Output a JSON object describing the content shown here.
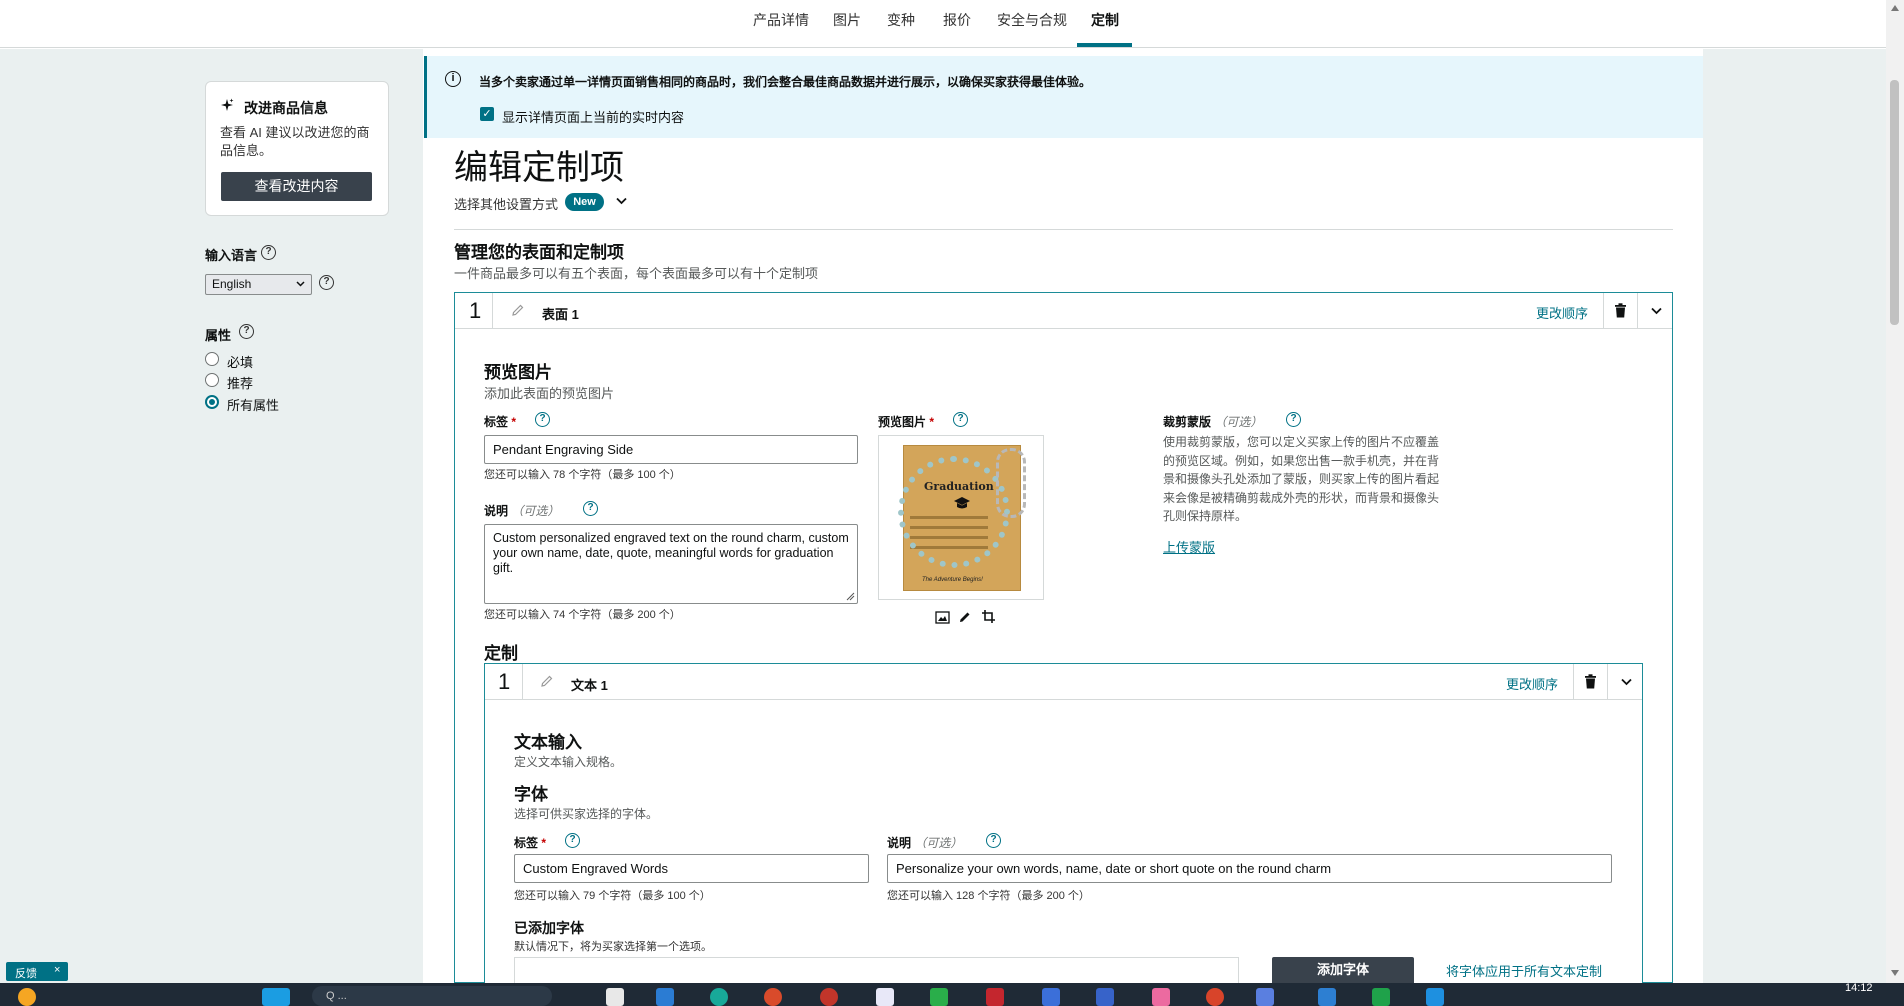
{
  "topnav": {
    "tabs": [
      "产品详情",
      "图片",
      "变种",
      "报价",
      "安全与合规",
      "定制"
    ],
    "active_index": 5
  },
  "sidebar": {
    "improve": {
      "title": "改进商品信息",
      "desc": "查看 AI 建议以改进您的商品信息。",
      "button": "查看改进内容"
    },
    "language": {
      "label": "输入语言",
      "value": "English"
    },
    "attributes": {
      "label": "属性",
      "options": [
        "必填",
        "推荐",
        "所有属性"
      ],
      "selected_index": 2
    }
  },
  "banner": {
    "text": "当多个卖家通过单一详情页面销售相同的商品时，我们会整合最佳商品数据并进行展示，以确保买家获得最佳体验。",
    "checkbox_label": "显示详情页面上当前的实时内容",
    "checked": true
  },
  "page": {
    "title": "编辑定制项",
    "setup_label": "选择其他设置方式",
    "badge": "New"
  },
  "manage": {
    "title": "管理您的表面和定制项",
    "subtitle": "一件商品最多可以有五个表面，每个表面最多可以有十个定制项"
  },
  "surface": {
    "index": "1",
    "name": "表面 1",
    "reorder": "更改顺序",
    "preview": {
      "title": "预览图片",
      "subtitle": "添加此表面的预览图片",
      "label_label": "标签",
      "label_value": "Pendant Engraving Side",
      "label_hint": "您还可以输入 78 个字符（最多 100 个）",
      "desc_label": "说明",
      "optional": "（可选）",
      "desc_value": "Custom personalized engraved text on the round charm, custom your own name, date, quote, meaningful words for graduation gift.",
      "desc_hint": "您还可以输入 74 个字符（最多 200 个）",
      "image_label": "预览图片",
      "image_heading": "Graduation",
      "image_footer": "The Adventure Begins!",
      "mask_label": "裁剪蒙版",
      "mask_text": "使用裁剪蒙版，您可以定义买家上传的图片不应覆盖的预览区域。例如，如果您出售一款手机壳，并在背景和摄像头孔处添加了蒙版，则买家上传的图片看起来会像是被精确剪裁成外壳的形状，而背景和摄像头孔则保持原样。",
      "mask_link": "上传蒙版"
    },
    "custom_title": "定制"
  },
  "text_item": {
    "index": "1",
    "name": "文本 1",
    "reorder": "更改顺序",
    "input_title": "文本输入",
    "input_sub": "定义文本输入规格。",
    "font_title": "字体",
    "font_sub": "选择可供买家选择的字体。",
    "label_label": "标签",
    "label_value": "Custom Engraved Words",
    "label_hint": "您还可以输入 79 个字符（最多 100 个）",
    "desc_label": "说明",
    "optional": "（可选）",
    "desc_value": "Personalize your own words, name, date or short quote on the round charm",
    "desc_hint": "您还可以输入 128 个字符（最多 200 个）",
    "added_title": "已添加字体",
    "added_sub": "默认情况下，将为买家选择第一个选项。",
    "add_font_button": "添加字体",
    "apply_link": "将字体应用于所有文本定制"
  },
  "feedback": {
    "label": "反馈",
    "close": "×"
  },
  "taskbar": {
    "time": "14:12",
    "search": "Q  ..."
  },
  "colors": {
    "teal": "#007185",
    "banner_bg": "#e6f6fc",
    "side_bg": "#eaf0f0",
    "dark_button": "#39424c"
  }
}
